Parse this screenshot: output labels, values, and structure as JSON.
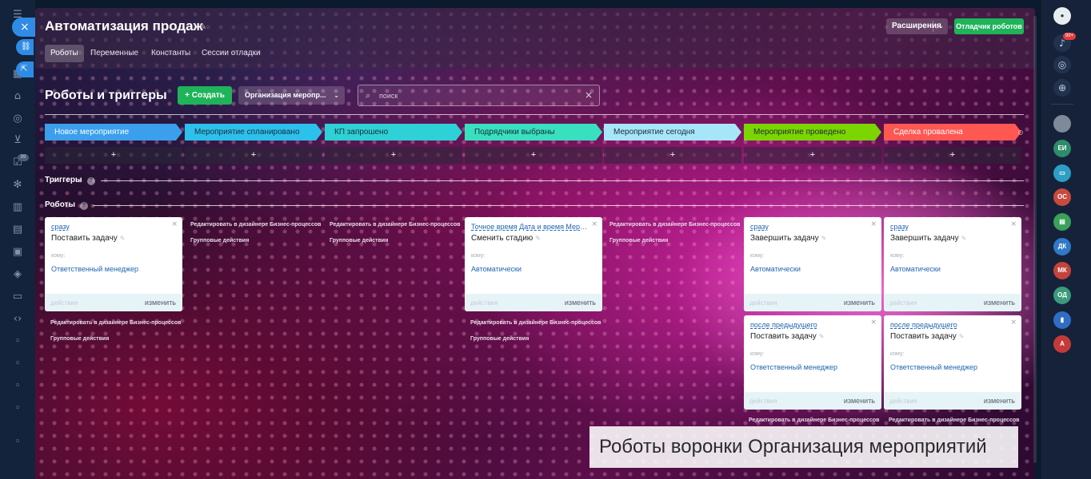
{
  "window": {
    "title": "Автоматизация продаж",
    "tabs": [
      "Роботы",
      "Переменные",
      "Константы",
      "Сессии отладки"
    ],
    "extensions_label": "Расширения",
    "debugger_label": "Отладчик роботов"
  },
  "toolbar": {
    "section_title": "Роботы и триггеры",
    "create_label": "Создать",
    "pipeline_value": "Организация меропр...",
    "search_placeholder": "поиск"
  },
  "stages": [
    {
      "name": "Новое мероприятие",
      "color": "#3b9fee",
      "text_color": "#ffffff"
    },
    {
      "name": "Мероприятие спланировано",
      "color": "#2cc1ec",
      "text_color": "#1d2b3a"
    },
    {
      "name": "КП запрошено",
      "color": "#2ed1d5",
      "text_color": "#1d2b3a"
    },
    {
      "name": "Подрядчики выбраны",
      "color": "#39e0c0",
      "text_color": "#1d2b3a"
    },
    {
      "name": "Мероприятие сегодня",
      "color": "#a6e6f8",
      "text_color": "#1d2b3a"
    },
    {
      "name": "Мероприятие проведено",
      "color": "#7bd500",
      "text_color": "#1d2b3a"
    },
    {
      "name": "Сделка провалена",
      "color": "#ff5752",
      "text_color": "#ffffff"
    }
  ],
  "add_label": "+",
  "groups": {
    "triggers": "Триггеры",
    "robots": "Роботы"
  },
  "help_glyph": "?",
  "links": {
    "edit_in_designer": "Редактировать в дизайнере Бизнес-процессов",
    "group_actions": "Групповые действия"
  },
  "robots": [
    {
      "delay": "сразу",
      "title": "Поставить задачу",
      "to_label": "кому:",
      "responsible": "Ответственный менеджер",
      "actions_label": "действия",
      "change_label": "изменить"
    },
    {
      "delay": "Точное время Дата и время Мероприятия",
      "title": "Сменить стадию",
      "to_label": "кому:",
      "responsible": "Автоматически",
      "actions_label": "действия",
      "change_label": "изменить"
    },
    {
      "delay": "сразу",
      "title": "Завершить задачу",
      "to_label": "кому:",
      "responsible": "Автоматически",
      "actions_label": "действия",
      "change_label": "изменить"
    },
    {
      "delay": "сразу",
      "title": "Завершить задачу",
      "to_label": "кому:",
      "responsible": "Автоматически",
      "actions_label": "действия",
      "change_label": "изменить"
    },
    {
      "delay": "после предыдущего",
      "title": "Поставить задачу",
      "to_label": "кому:",
      "responsible": "Ответственный менеджер",
      "actions_label": "действия",
      "change_label": "изменить"
    },
    {
      "delay": "после предыдущего",
      "title": "Поставить задачу",
      "to_label": "кому:",
      "responsible": "Ответственный менеджер",
      "actions_label": "действия",
      "change_label": "изменить"
    }
  ],
  "caption": "Роботы воронки Организация мероприятий",
  "right_rail": {
    "notification_badge": "99+",
    "avatars": [
      "ЕИ",
      "",
      "ОС",
      "",
      "ДК",
      "МК",
      "ОД",
      "",
      "А"
    ],
    "avatar_colors": [
      "#7e8a9a",
      "#2d8c6a",
      "#2d9fc4",
      "#c74a3f",
      "#3aa05a",
      "#2f79c8",
      "#c4433a",
      "#3a9a7a",
      "#2f6ec4",
      "#c43a3a"
    ]
  },
  "left_rail": {
    "badge": "99"
  }
}
